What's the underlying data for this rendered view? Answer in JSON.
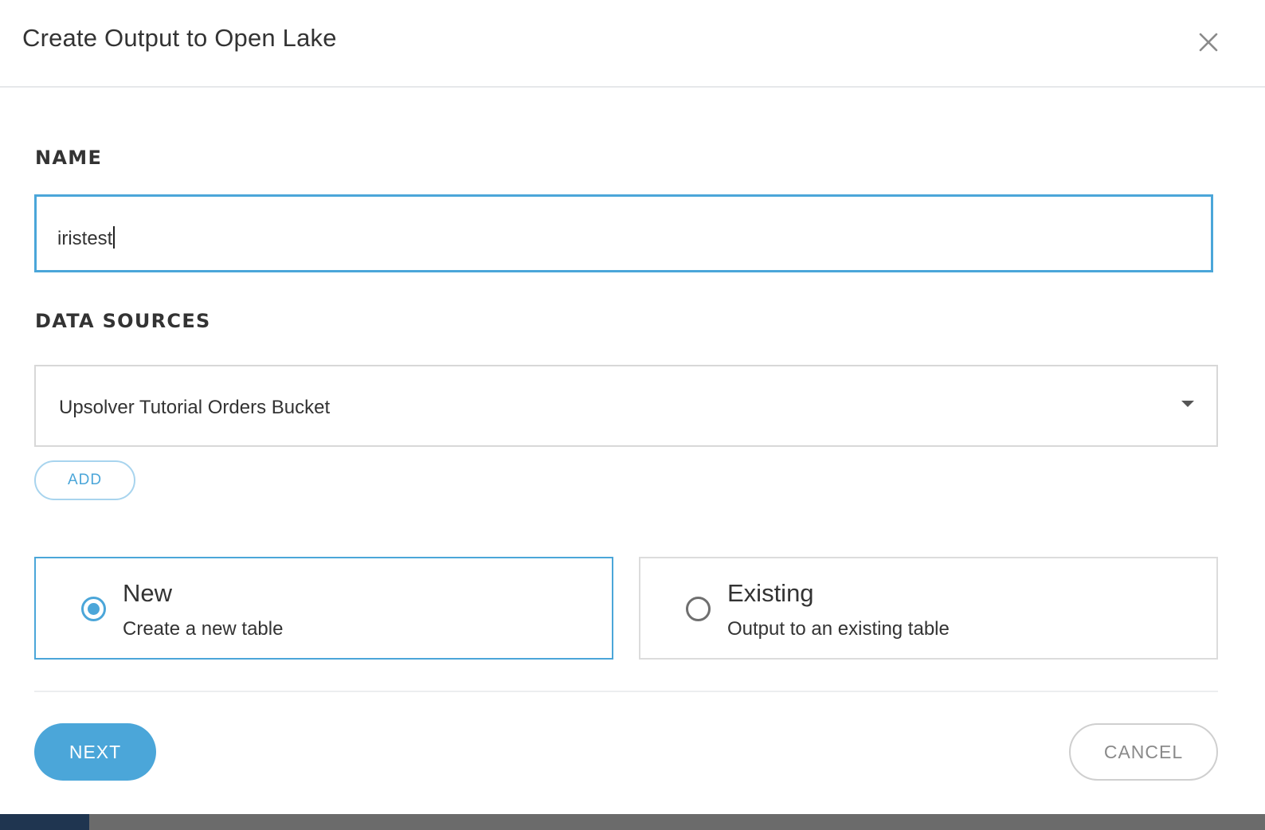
{
  "dialog": {
    "title": "Create Output to Open Lake",
    "close_icon": "close-icon"
  },
  "name_section": {
    "label": "NAME",
    "value": "iristest"
  },
  "data_sources_section": {
    "label": "DATA SOURCES",
    "selected": "Upsolver Tutorial Orders Bucket",
    "add_label": "ADD"
  },
  "table_options": [
    {
      "title": "New",
      "description": "Create a new table",
      "selected": true
    },
    {
      "title": "Existing",
      "description": "Output to an existing table",
      "selected": false
    }
  ],
  "footer": {
    "next_label": "NEXT",
    "cancel_label": "CANCEL"
  },
  "colors": {
    "accent": "#4ba6d9",
    "text": "#333333",
    "border": "#d8d8d8"
  }
}
